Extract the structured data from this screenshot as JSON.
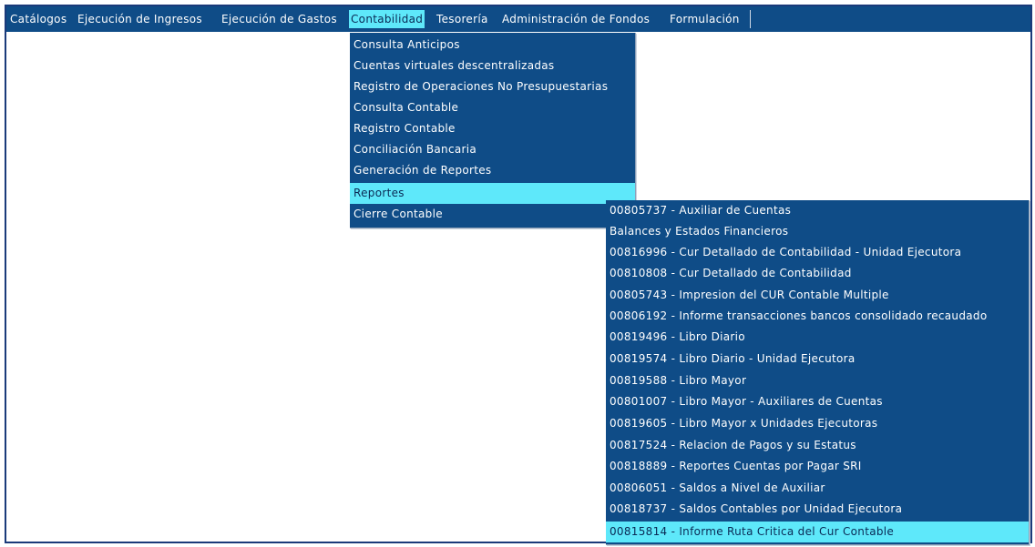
{
  "menubar": {
    "items": [
      {
        "label": "Catálogos"
      },
      {
        "label": "Ejecución de Ingresos"
      },
      {
        "label": "Ejecución de Gastos"
      },
      {
        "label": "Contabilidad"
      },
      {
        "label": "Tesorería"
      },
      {
        "label": "Administración de Fondos"
      },
      {
        "label": "Formulación"
      }
    ],
    "active": "Contabilidad"
  },
  "contabilidad_menu": {
    "items": [
      {
        "label": "Consulta Anticipos"
      },
      {
        "label": "Cuentas virtuales descentralizadas"
      },
      {
        "label": "Registro de Operaciones No Presupuestarias"
      },
      {
        "label": "Consulta Contable"
      },
      {
        "label": "Registro Contable"
      },
      {
        "label": "Conciliación Bancaria"
      },
      {
        "label": "Generación de Reportes"
      },
      {
        "label": "Reportes"
      },
      {
        "label": "Cierre Contable"
      }
    ],
    "highlighted": "Reportes"
  },
  "reportes_menu": {
    "items": [
      {
        "label": "00805737 - Auxiliar de Cuentas"
      },
      {
        "label": "Balances y Estados Financieros"
      },
      {
        "label": "00816996 - Cur Detallado de Contabilidad - Unidad Ejecutora"
      },
      {
        "label": "00810808 - Cur Detallado de Contabilidad"
      },
      {
        "label": "00805743 - Impresion del CUR Contable Multiple"
      },
      {
        "label": "00806192 - Informe transacciones bancos consolidado recaudado"
      },
      {
        "label": "00819496 - Libro Diario"
      },
      {
        "label": "00819574 - Libro Diario - Unidad Ejecutora"
      },
      {
        "label": "00819588 - Libro Mayor"
      },
      {
        "label": "00801007 - Libro Mayor - Auxiliares de Cuentas"
      },
      {
        "label": "00819605 - Libro Mayor x Unidades Ejecutoras"
      },
      {
        "label": "00817524 - Relacion de Pagos y su Estatus"
      },
      {
        "label": "00818889 - Reportes Cuentas por Pagar SRI"
      },
      {
        "label": "00806051 - Saldos a Nivel de Auxiliar"
      },
      {
        "label": "00818737 - Saldos Contables por Unidad Ejecutora"
      },
      {
        "label": "00815814 - Informe Ruta Critica del Cur Contable"
      }
    ],
    "highlighted": "00815814 - Informe Ruta Critica del Cur Contable"
  },
  "colors": {
    "menu_background": "#0f4c87",
    "highlight": "#5ee8fa",
    "frame_border": "#1a3a7a"
  }
}
